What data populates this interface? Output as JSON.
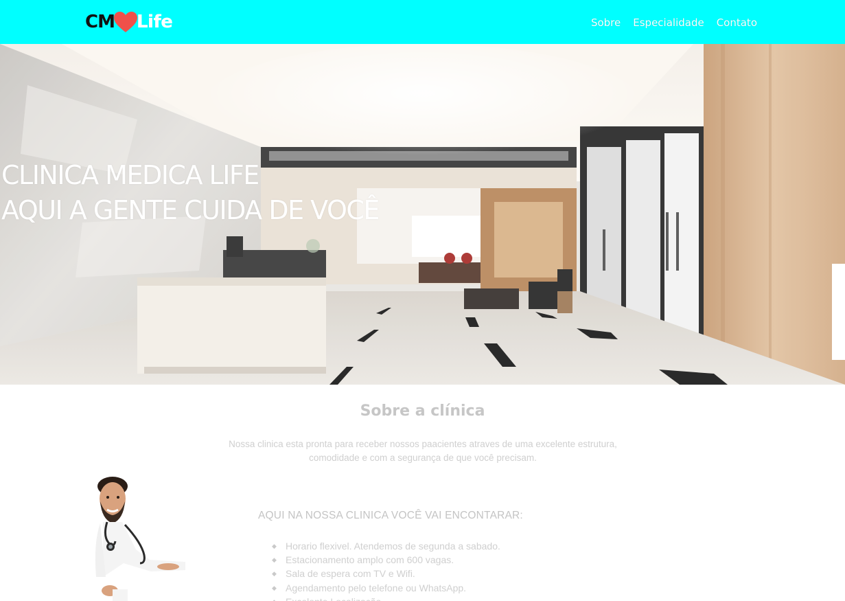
{
  "header": {
    "logo": {
      "left_text": "CM",
      "right_text": "Life",
      "icon": "heart-icon",
      "heart_color": "#f0504a"
    },
    "nav": [
      "Sobre",
      "Especialidade",
      "Contato"
    ],
    "background": "#00ffff"
  },
  "hero": {
    "line1": "CLINICA MEDICA LIFE",
    "line2": "AQUI A GENTE CUIDA DE VOCÊ"
  },
  "about": {
    "title": "Sobre a clínica",
    "text": "Nossa clinica esta pronta para receber nossos paacientes atraves de uma excelente estrutura, comodidade e com a segurança de que você precisam.",
    "features_heading": "AQUI NA NOSSA CLINICA VOCÊ VAI ENCONTARAR:",
    "features": [
      "Horario flexivel. Atendemos de segunda a sabado.",
      "Estacionamento amplo com 600 vagas.",
      "Sala de espera com TV e Wifi.",
      "Agendamento pelo telefone ou WhatsApp.",
      "Excelente Localização."
    ]
  }
}
